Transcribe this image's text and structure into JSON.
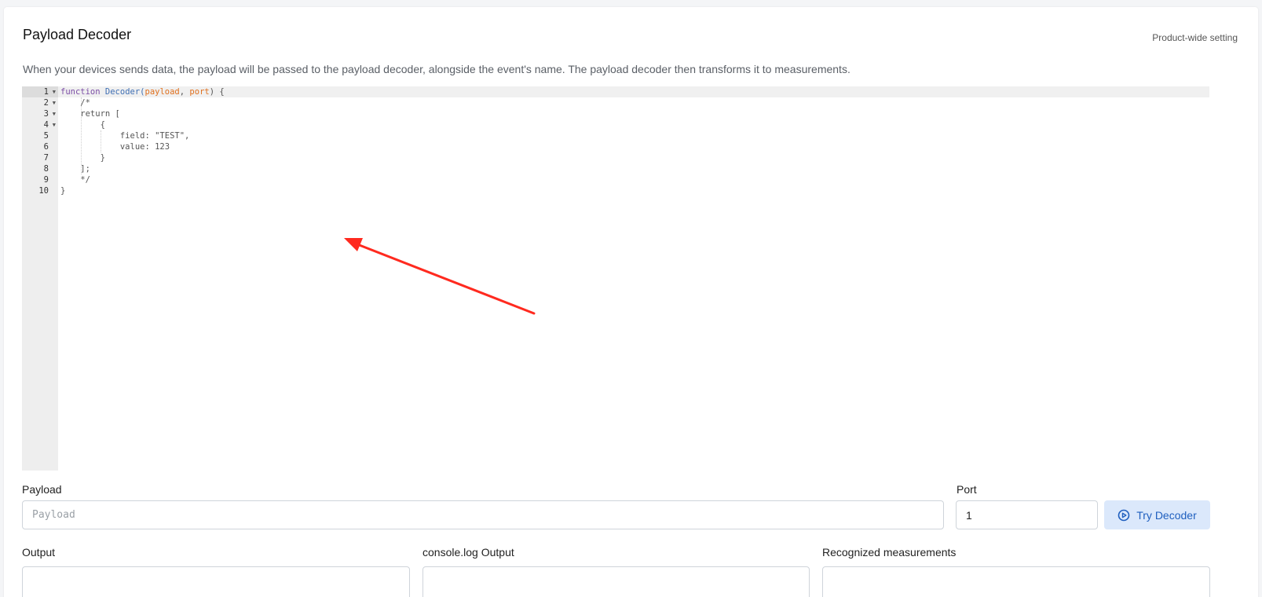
{
  "card": {
    "title": "Payload Decoder",
    "meta": "Product-wide setting",
    "description": "When your devices sends data, the payload will be passed to the payload decoder, alongside the event's name. The payload decoder then transforms it to measurements."
  },
  "editor": {
    "line_numbers": [
      "1",
      "2",
      "3",
      "4",
      "5",
      "6",
      "7",
      "8",
      "9",
      "10"
    ],
    "line1": {
      "keyword": "function",
      "name": "Decoder",
      "open": "(",
      "param1": "payload",
      "sep": ", ",
      "param2": "port",
      "close": ") {"
    },
    "lines": [
      "    /*",
      "    return [",
      "        {",
      "            field: \"TEST\",",
      "            value: 123",
      "        }",
      "    ];",
      "    */",
      "}"
    ]
  },
  "payload": {
    "label": "Payload",
    "placeholder": "Payload",
    "value": ""
  },
  "port": {
    "label": "Port",
    "value": "1"
  },
  "try_button": {
    "label": "Try Decoder",
    "icon": "play-circle-icon"
  },
  "outputs": {
    "output_label": "Output",
    "console_label": "console.log Output",
    "measurements_label": "Recognized measurements"
  },
  "colors": {
    "annotation_arrow": "#ff2a1f",
    "button_bg": "#dbe8fb",
    "button_text": "#1f5fbf"
  }
}
